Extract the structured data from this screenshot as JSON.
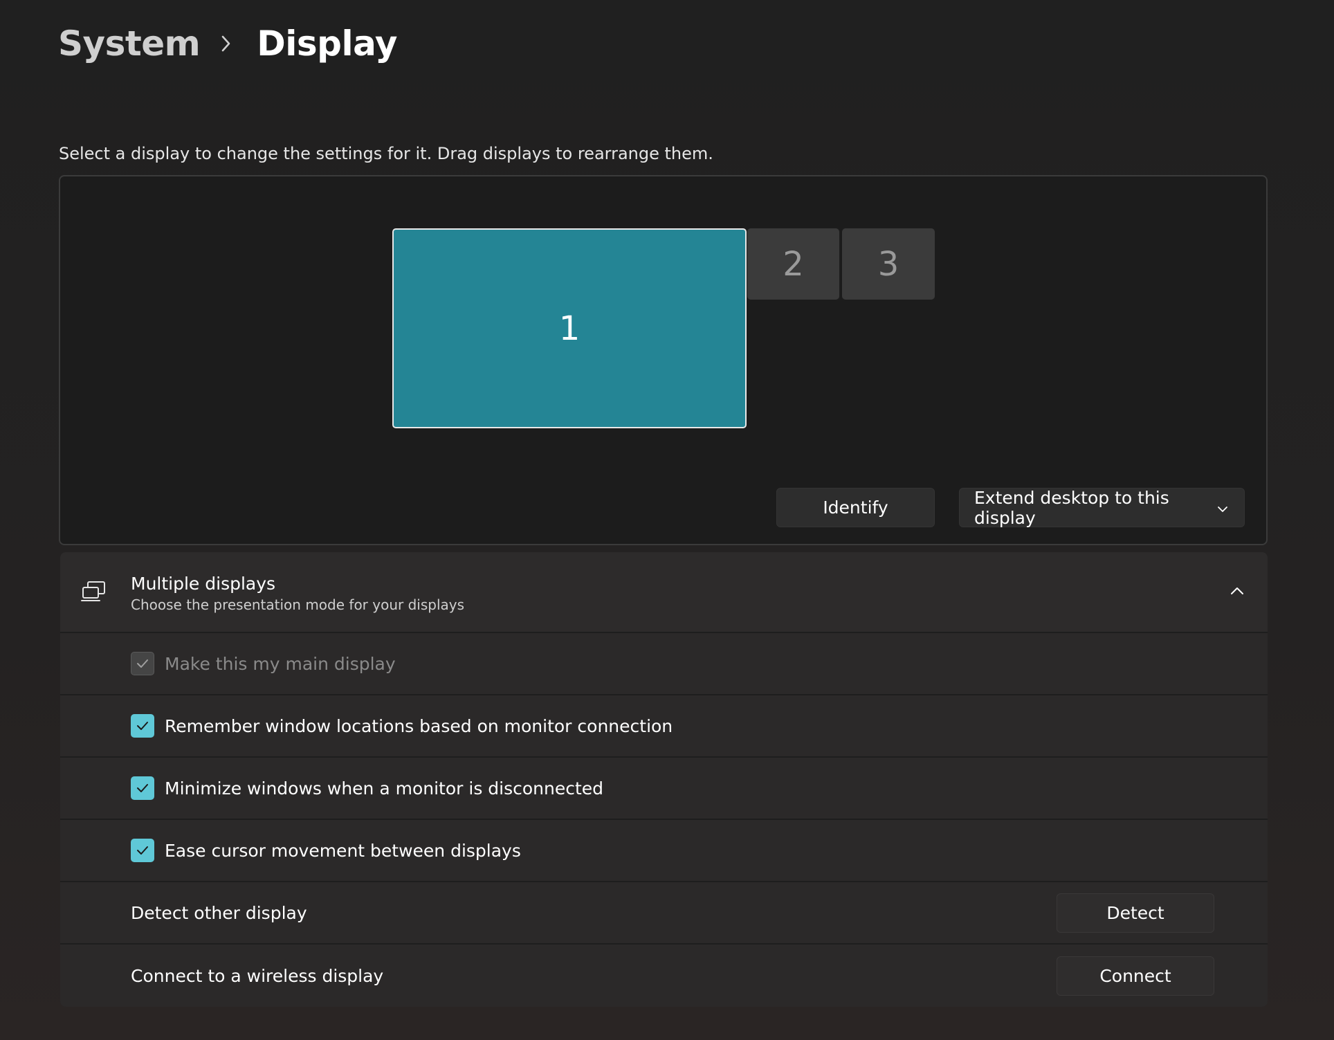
{
  "breadcrumb": {
    "parent": "System",
    "current": "Display"
  },
  "arrange": {
    "hint": "Select a display to change the settings for it. Drag displays to rearrange them.",
    "monitors": [
      {
        "label": "1",
        "selected": true
      },
      {
        "label": "2",
        "selected": false
      },
      {
        "label": "3",
        "selected": false
      }
    ],
    "identify_label": "Identify",
    "mode_selected": "Extend desktop to this display"
  },
  "multiple_displays": {
    "title": "Multiple displays",
    "subtitle": "Choose the presentation mode for your displays",
    "expanded": true,
    "options": [
      {
        "label": "Make this my main display",
        "checked": true,
        "disabled": true
      },
      {
        "label": "Remember window locations based on monitor connection",
        "checked": true,
        "disabled": false
      },
      {
        "label": "Minimize windows when a monitor is disconnected",
        "checked": true,
        "disabled": false
      },
      {
        "label": "Ease cursor movement between displays",
        "checked": true,
        "disabled": false
      }
    ],
    "detect": {
      "label": "Detect other display",
      "button": "Detect"
    },
    "connect": {
      "label": "Connect to a wireless display",
      "button": "Connect"
    }
  },
  "colors": {
    "accent": "#5fc8d7",
    "selected_monitor": "#248595",
    "background": "#202020"
  }
}
